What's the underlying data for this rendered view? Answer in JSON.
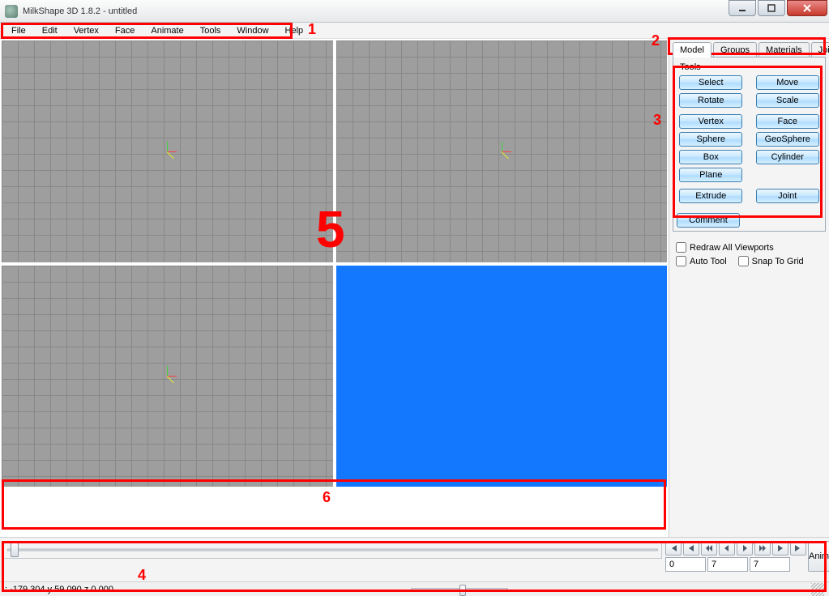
{
  "title": "MilkShape 3D 1.8.2 - untitled",
  "menus": [
    "File",
    "Edit",
    "Vertex",
    "Face",
    "Animate",
    "Tools",
    "Window",
    "Help"
  ],
  "side": {
    "tabs": [
      "Model",
      "Groups",
      "Materials",
      "Joints"
    ],
    "active_tab_index": 0,
    "tools_label": "Tools",
    "buttons_row1": [
      "Select",
      "Move",
      "Rotate",
      "Scale"
    ],
    "buttons_row2": [
      "Vertex",
      "Face",
      "Sphere",
      "GeoSphere",
      "Box",
      "Cylinder",
      "Plane"
    ],
    "buttons_row3": [
      "Extrude",
      "Joint"
    ],
    "comment_label": "Comment",
    "checks": {
      "redraw": "Redraw All Viewports",
      "auto_tool": "Auto Tool",
      "snap": "Snap To Grid"
    }
  },
  "anim": {
    "button_label": "Anim",
    "fields": {
      "start": "0",
      "mid": "7",
      "end": "7"
    }
  },
  "status": ": -179.304 y 59.090 z 0.000",
  "annotations": {
    "n1": "1",
    "n2": "2",
    "n3": "3",
    "n4": "4",
    "n5": "5",
    "n6": "6"
  }
}
